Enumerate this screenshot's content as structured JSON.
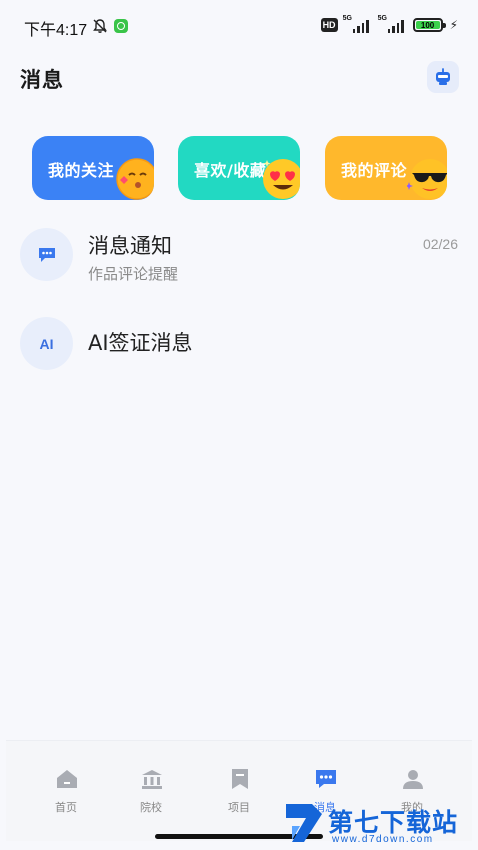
{
  "status_bar": {
    "time": "下午4:17",
    "hd_label": "HD",
    "sim1_label": "5G",
    "sim2_label": "5G",
    "battery_level": "100"
  },
  "header": {
    "title": "消息"
  },
  "cards": [
    {
      "label": "我的关注",
      "color": "#3b82f5"
    },
    {
      "label": "喜欢/收藏",
      "color": "#22d9c2"
    },
    {
      "label": "我的评论",
      "color": "#ffb82c"
    }
  ],
  "messages": [
    {
      "title": "消息通知",
      "subtitle": "作品评论提醒",
      "date": "02/26",
      "icon": "chat-bubble-icon"
    },
    {
      "title": "AI签证消息",
      "icon_text": "AI"
    }
  ],
  "bottom_nav": [
    {
      "label": "首页",
      "icon": "home-icon"
    },
    {
      "label": "院校",
      "icon": "university-icon"
    },
    {
      "label": "项目",
      "icon": "bookmark-icon"
    },
    {
      "label": "消息",
      "icon": "message-icon",
      "active": true
    },
    {
      "label": "我的",
      "icon": "profile-icon"
    }
  ],
  "watermark": {
    "title": "第七下载站",
    "url": "www.d7down.com"
  },
  "colors": {
    "accent": "#3a78ee",
    "nav_inactive": "#888888"
  }
}
